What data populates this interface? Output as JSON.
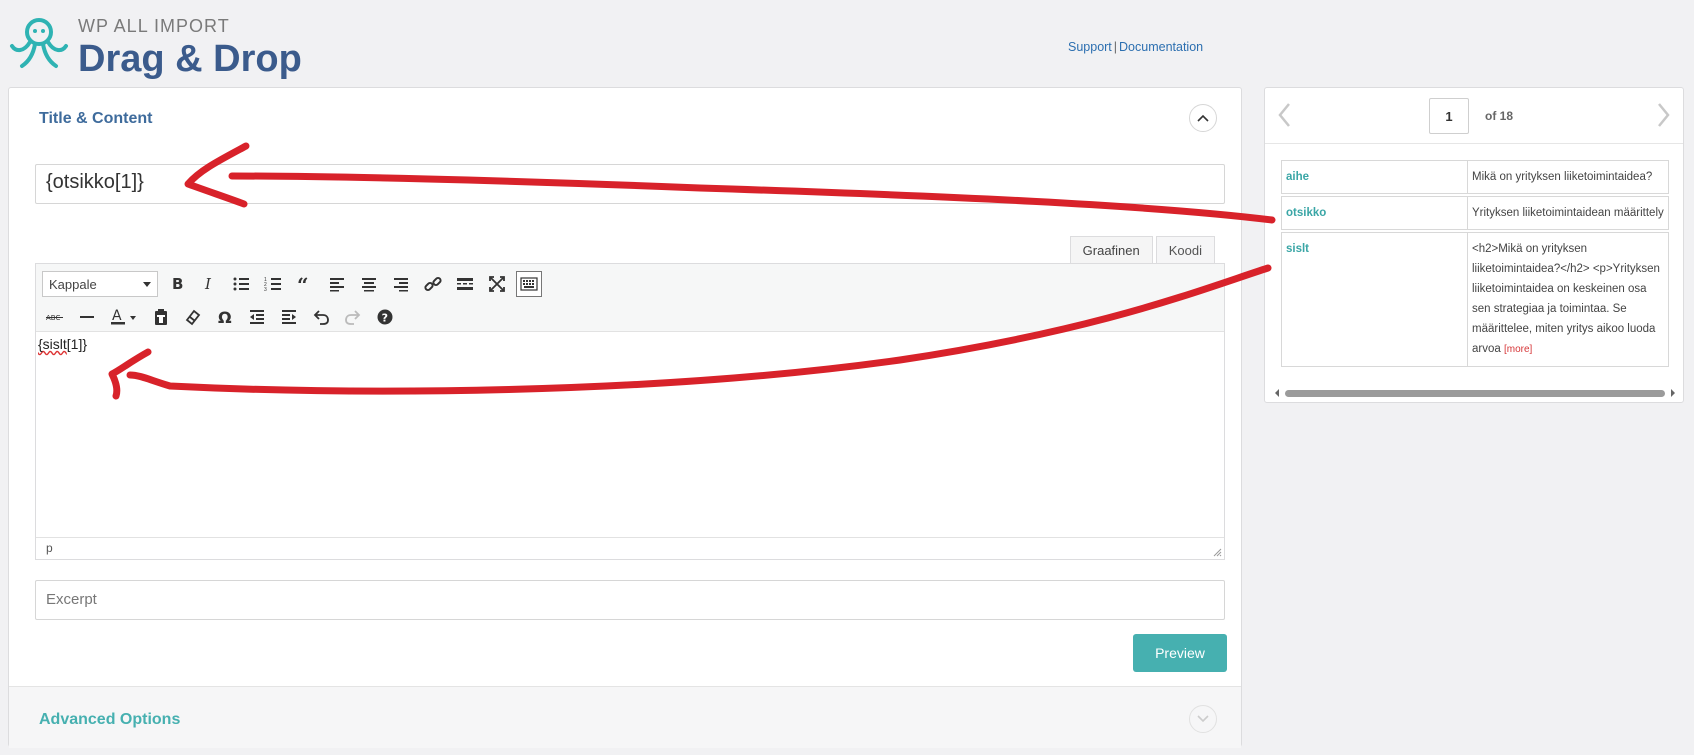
{
  "brand": {
    "sub": "WP ALL IMPORT",
    "title": "Drag & Drop"
  },
  "toplinks": {
    "support": "Support",
    "separator": "|",
    "documentation": "Documentation"
  },
  "panel": {
    "title": "Title & Content",
    "title_field_value": "{otsikko[1]}",
    "tabs": [
      "Graafinen",
      "Koodi"
    ],
    "format_select": "Kappale",
    "editor_content_a": "{sislt",
    "editor_content_b": "[1]}",
    "status_path": "p",
    "excerpt_placeholder": "Excerpt",
    "preview_label": "Preview",
    "advanced_title": "Advanced Options"
  },
  "side": {
    "page": "1",
    "of": "of 18",
    "rows": [
      {
        "key": "aihe",
        "value": "Mikä on yrityksen liiketoimintaidea?"
      },
      {
        "key": "otsikko",
        "value": "Yrityksen liiketoimintaidean määrittely"
      },
      {
        "key": "sislt",
        "value": "<h2>Mikä on yrityksen liiketoimintaidea?</h2> <p>Yrityksen liiketoimintaidea on keskeinen osa sen strategiaa ja toimintaa. Se määrittelee, miten yritys aikoo luoda arvoa",
        "more": "[more]"
      }
    ]
  },
  "colors": {
    "brand_blue": "#3b5b8c",
    "teal": "#46b0b0",
    "annotation_red": "#d8222a"
  }
}
